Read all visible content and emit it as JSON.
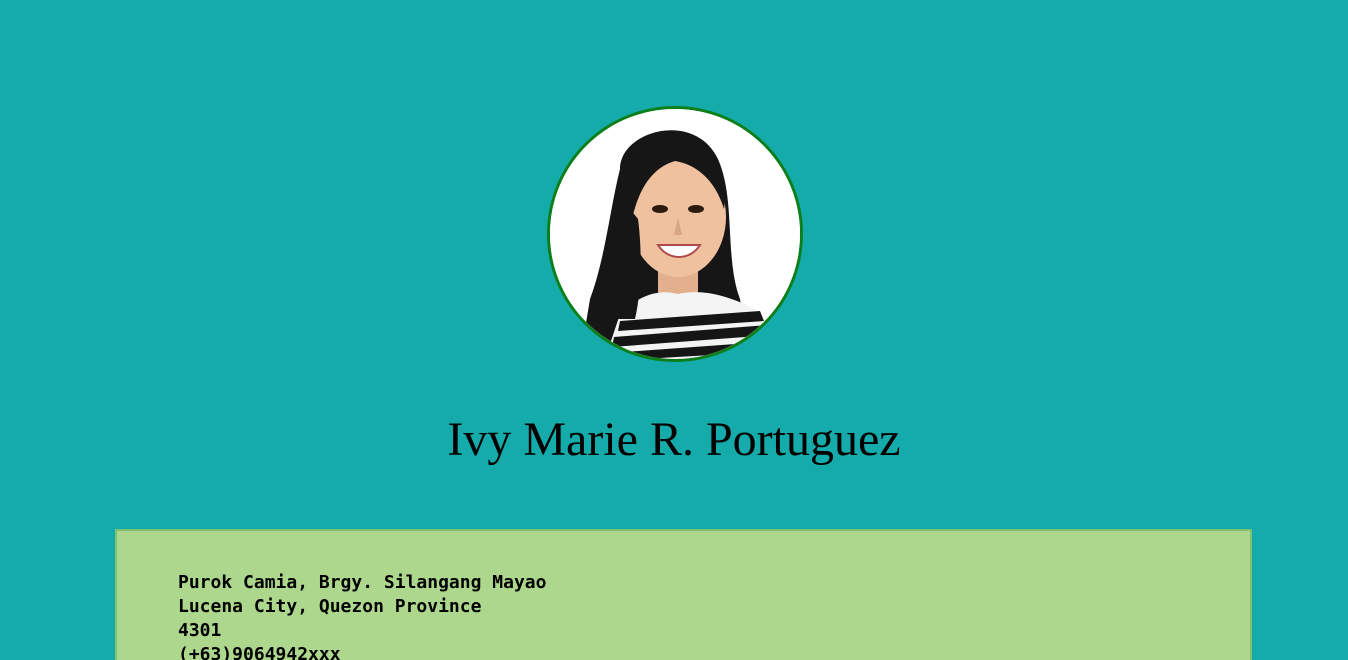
{
  "profile": {
    "photo_alt": "profile photo",
    "name": "Ivy Marie R. Portuguez"
  },
  "contact": {
    "address_line1": "Purok Camia, Brgy. Silangang Mayao",
    "address_line2": "Lucena City, Quezon Province",
    "postal_code": "4301",
    "phone": "(+63)9064942xxx"
  },
  "colors": {
    "page_background": "#16abab",
    "avatar_border": "#0b7f1a",
    "info_box_background": "#add78c"
  }
}
